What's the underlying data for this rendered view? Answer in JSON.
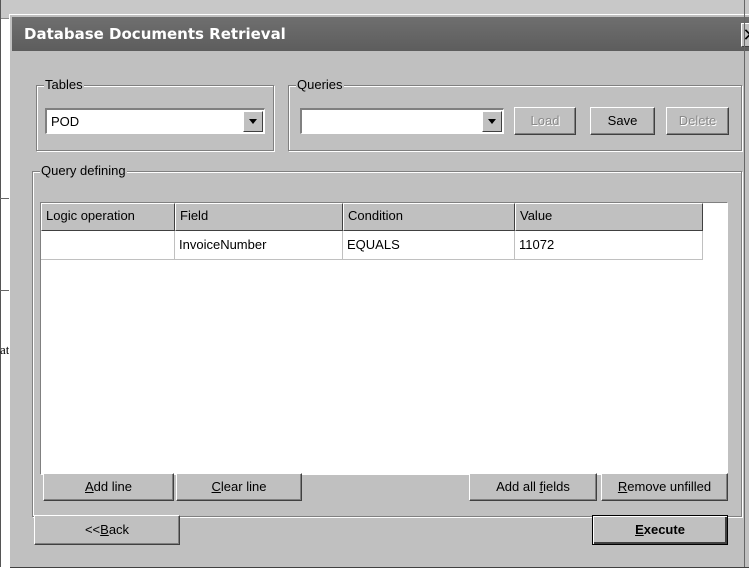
{
  "background": {
    "fragment_text": "at"
  },
  "window": {
    "title": "Database Documents Retrieval",
    "close_glyph": "✕"
  },
  "tables_group": {
    "label": "Tables",
    "selected_value": "POD"
  },
  "queries_group": {
    "label": "Queries",
    "selected_value": "",
    "load_label": "Load",
    "save_label": "Save",
    "delete_label": "Delete"
  },
  "query_group": {
    "label": "Query defining",
    "columns": [
      "Logic operation",
      "Field",
      "Condition",
      "Value"
    ],
    "rows": [
      {
        "logic": "",
        "field": "InvoiceNumber",
        "condition": "EQUALS",
        "value": "11072"
      }
    ],
    "add_line": {
      "mnemonic": "A",
      "rest": "dd line"
    },
    "clear_line": {
      "mnemonic": "C",
      "rest": "lear line"
    },
    "add_all_fields": {
      "pre": "Add all ",
      "mnemonic": "f",
      "rest": "ields"
    },
    "remove_unfilled": {
      "mnemonic": "R",
      "rest": "emove unfilled"
    }
  },
  "footer": {
    "back": {
      "pre": "<<",
      "mnemonic": "B",
      "rest": "ack"
    },
    "execute": {
      "mnemonic": "E",
      "rest": "xecute"
    }
  },
  "colors": {
    "titlebar": "#666666",
    "face": "#c0c0c0",
    "disabled_text": "#8a8a8a"
  }
}
